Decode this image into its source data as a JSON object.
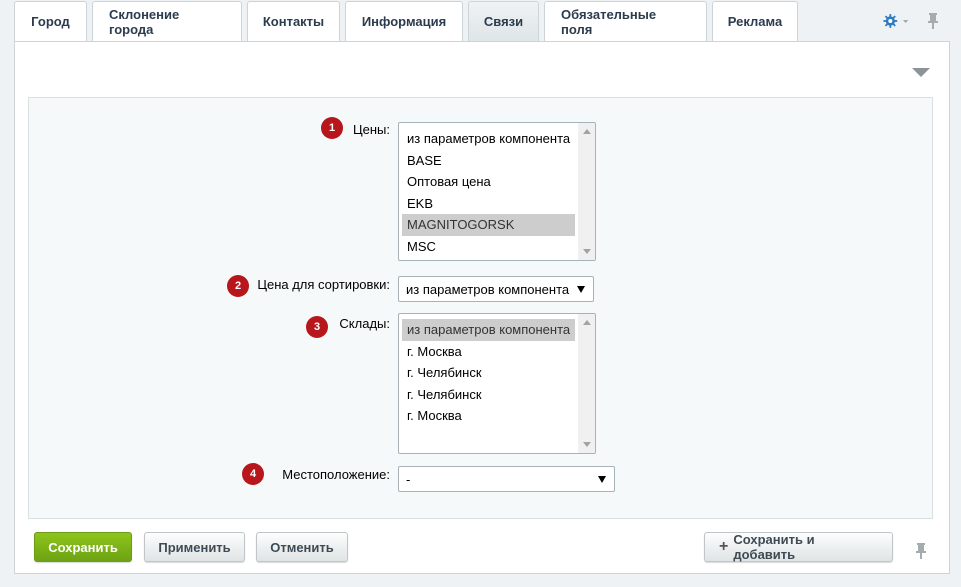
{
  "tabs": [
    {
      "label": "Город"
    },
    {
      "label": "Склонение города"
    },
    {
      "label": "Контакты"
    },
    {
      "label": "Информация"
    },
    {
      "label": "Связи",
      "active": true
    },
    {
      "label": "Обязательные поля"
    },
    {
      "label": "Реклама"
    }
  ],
  "icons": {
    "settings": "gear-icon",
    "pin": "pin-icon",
    "collapse": "triangle-down-icon",
    "add": "plus-icon"
  },
  "colors": {
    "accent_green": "#7ab317",
    "badge_red": "#b7161c",
    "gear_blue": "#2f7bc0"
  },
  "form": {
    "prices": {
      "badge": "1",
      "label": "Цены:",
      "options": [
        "из параметров компонента",
        "BASE",
        "Оптовая цена",
        "EKB",
        "MAGNITOGORSK",
        "MSC"
      ],
      "selected": "MAGNITOGORSK"
    },
    "sort_price": {
      "badge": "2",
      "label": "Цена для сортировки:",
      "value": "из параметров компонента"
    },
    "stores": {
      "badge": "3",
      "label": "Склады:",
      "options": [
        "из параметров компонента",
        "г. Москва",
        "г. Челябинск",
        "г. Челябинск",
        "г. Москва"
      ],
      "selected": "из параметров компонента"
    },
    "location": {
      "badge": "4",
      "label": "Местоположение:",
      "value": "-"
    }
  },
  "buttons": {
    "save": "Сохранить",
    "apply": "Применить",
    "cancel": "Отменить",
    "save_add": "Сохранить и добавить"
  }
}
